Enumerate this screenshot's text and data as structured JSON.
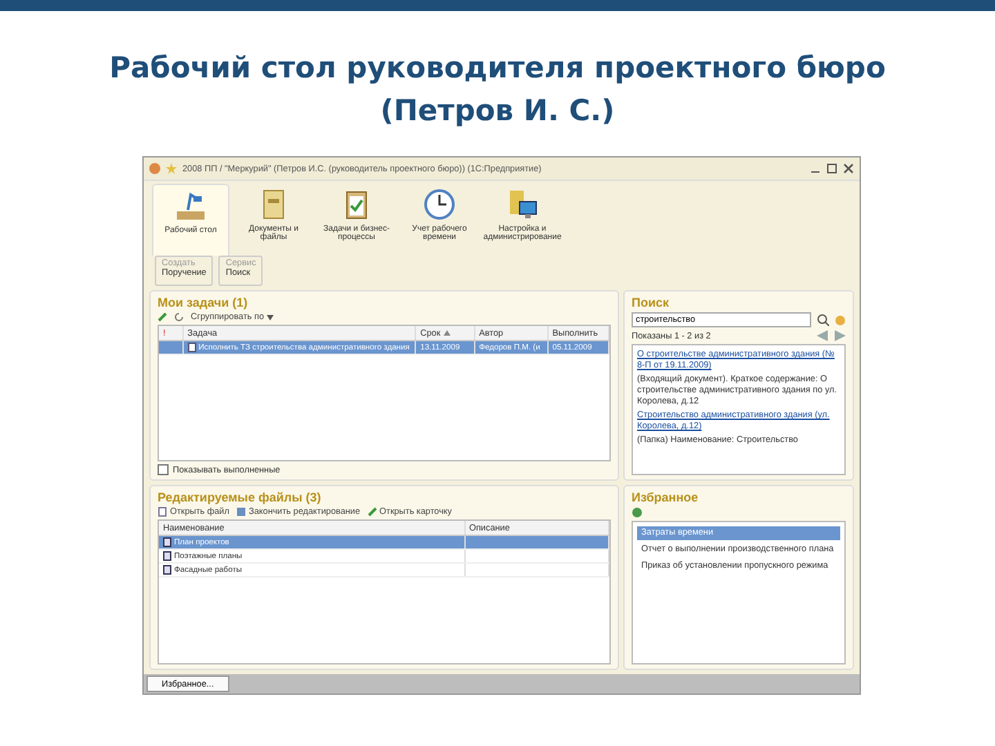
{
  "slide_title": [
    "Рабочий стол руководителя проектного бюро",
    "(Петров И. С.)"
  ],
  "window": {
    "title": "2008 ПП / \"Меркурий\" (Петров И.С. (руководитель проектного бюро)) (1С:Предприятие)"
  },
  "sections": [
    {
      "label": "Рабочий стол",
      "selected": true
    },
    {
      "label": "Документы и файлы",
      "selected": false
    },
    {
      "label": "Задачи и бизнес-процессы",
      "selected": false
    },
    {
      "label": "Учет рабочего времени",
      "selected": false
    },
    {
      "label": "Настройка и администрирование",
      "selected": false
    }
  ],
  "actions": [
    {
      "group": "Создать",
      "label": "Поручение"
    },
    {
      "group": "Сервис",
      "label": "Поиск"
    }
  ],
  "tasks": {
    "title": "Мои задачи (1)",
    "toolbar": [
      "Сгруппировать по"
    ],
    "columns": [
      "!",
      "Задача",
      "Срок",
      "Автор",
      "Выполнить"
    ],
    "rows": [
      {
        "cells": [
          "",
          "Исполнить ТЗ строительства административного здания",
          "13.11.2009",
          "Федоров П.М. (и",
          "05.11.2009"
        ],
        "selected": true
      }
    ],
    "show_completed": {
      "label": "Показывать выполненные",
      "checked": false
    }
  },
  "search": {
    "title": "Поиск",
    "value": "строительство",
    "summary": "Показаны 1 - 2 из 2",
    "results": [
      {
        "link": "О строительстве административного здания (№ 8-П от 19.11.2009)",
        "text": "(Входящий документ). Краткое содержание: О строительстве административного здания по ул. Королева, д.12"
      },
      {
        "link": "Строительство административного здания (ул. Королева, д.12)",
        "text": "(Папка) Наименование: Строительство"
      }
    ]
  },
  "files": {
    "title": "Редактируемые файлы (3)",
    "toolbar": [
      "Открыть файл",
      "Закончить редактирование",
      "Открыть карточку"
    ],
    "columns": [
      "Наименование",
      "Описание"
    ],
    "rows": [
      {
        "name": "План проектов",
        "selected": true
      },
      {
        "name": "Поэтажные планы",
        "selected": false
      },
      {
        "name": "Фасадные работы",
        "selected": false
      }
    ]
  },
  "favorites": {
    "title": "Избранное",
    "items": [
      {
        "label": "Затраты времени",
        "selected": true
      },
      {
        "label": "Отчет о выполнении производственного плана",
        "selected": false
      },
      {
        "label": "Приказ об установлении пропускного режима",
        "selected": false
      }
    ]
  },
  "taskbar": [
    "Избранное..."
  ]
}
